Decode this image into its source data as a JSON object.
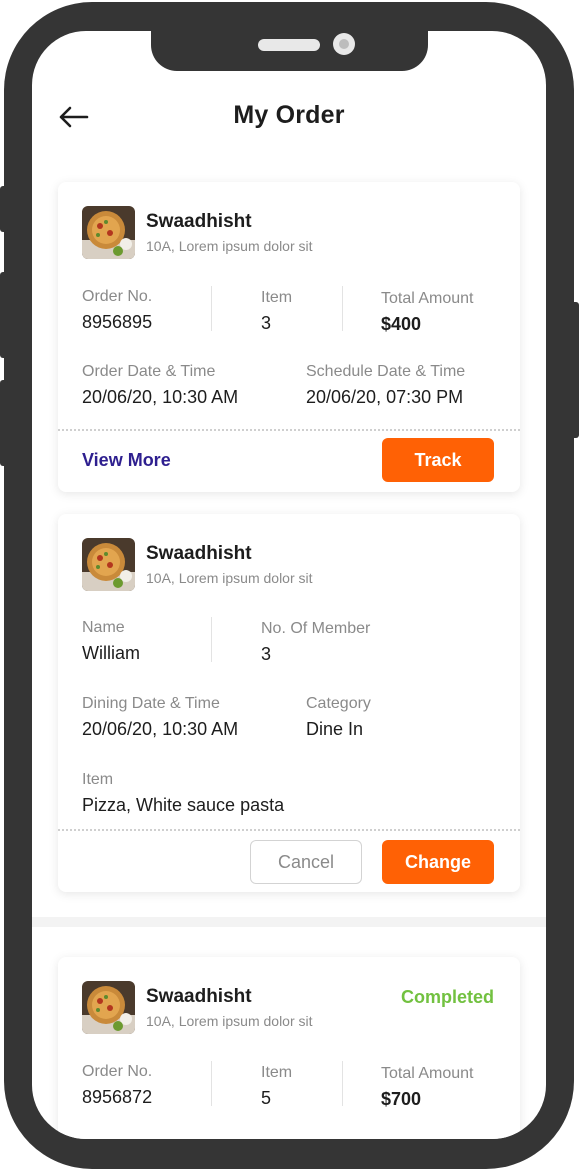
{
  "header": {
    "title": "My Order",
    "back_icon": "arrow-left-icon"
  },
  "colors": {
    "accent": "#ff6105",
    "link": "#2e1f8f",
    "completed": "#72c140"
  },
  "orders": [
    {
      "restaurant": "Swaadhisht",
      "address": "10A, Lorem ipsum dolor sit",
      "order_no_label": "Order No.",
      "order_no": "8956895",
      "item_label": "Item",
      "item": "3",
      "total_label": "Total Amount",
      "total": "$400",
      "order_date_label": "Order Date & Time",
      "order_date": "20/06/20, 10:30 AM",
      "schedule_label": "Schedule Date & Time",
      "schedule_date": "20/06/20, 07:30 PM",
      "view_more": "View More",
      "track": "Track"
    },
    {
      "restaurant": "Swaadhisht",
      "address": "10A, Lorem ipsum dolor sit",
      "name_label": "Name",
      "name": "William",
      "members_label": "No. Of Member",
      "members": "3",
      "dining_label": "Dining Date & Time",
      "dining_date": "20/06/20, 10:30 AM",
      "category_label": "Category",
      "category": "Dine In",
      "item_label": "Item",
      "items": "Pizza, White sauce pasta",
      "cancel": "Cancel",
      "change": "Change"
    },
    {
      "restaurant": "Swaadhisht",
      "address": "10A, Lorem ipsum dolor sit",
      "status": "Completed",
      "order_no_label": "Order No.",
      "order_no": "8956872",
      "item_label": "Item",
      "item": "5",
      "total_label": "Total Amount",
      "total": "$700"
    }
  ]
}
